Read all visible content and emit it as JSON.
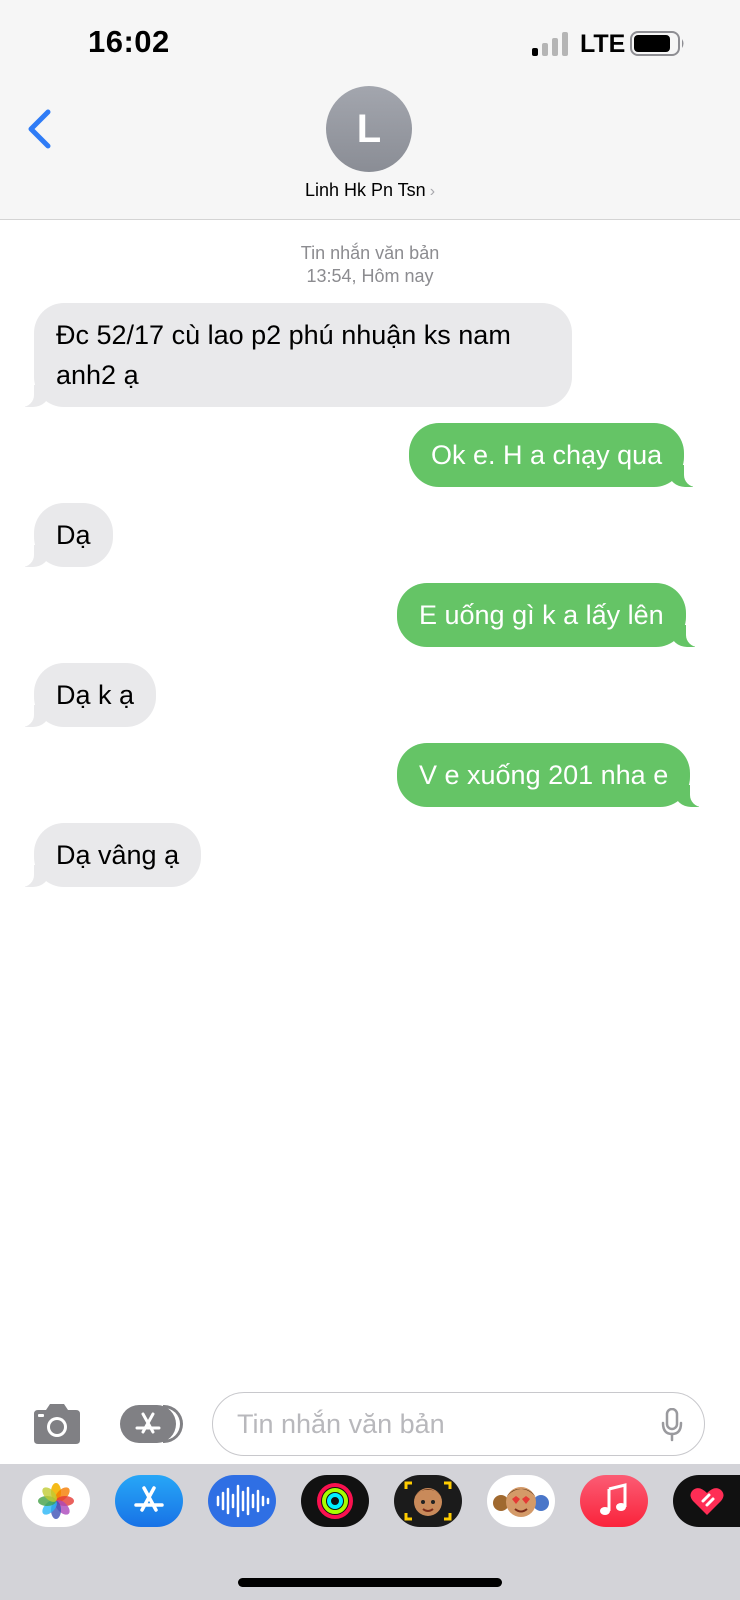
{
  "status": {
    "time": "16:02",
    "network": "LTE"
  },
  "contact": {
    "initial": "L",
    "name": "Linh Hk Pn Tsn",
    "chevron": "›"
  },
  "conversation": {
    "service_label": "Tin nhắn văn bản",
    "timestamp": "13:54, Hôm nay",
    "messages": [
      {
        "direction": "incoming",
        "text": "Đc 52/17 cù lao p2 phú nhuận ks nam anh2 ạ"
      },
      {
        "direction": "outgoing",
        "text": "Ok e. H a chạy qua"
      },
      {
        "direction": "incoming",
        "text": "Dạ"
      },
      {
        "direction": "outgoing",
        "text": "E uống gì k a lấy lên"
      },
      {
        "direction": "incoming",
        "text": "Dạ k ạ"
      },
      {
        "direction": "outgoing",
        "text": "V e xuống 201 nha e"
      },
      {
        "direction": "incoming",
        "text": "Dạ vâng ạ"
      }
    ]
  },
  "composer": {
    "placeholder": "Tin nhắn văn bản"
  },
  "app_drawer": [
    "photos-icon",
    "app-store-icon",
    "audio-message-icon",
    "activity-icon",
    "memoji-stickers-icon",
    "memoji-icon",
    "music-icon",
    "digital-touch-icon"
  ],
  "colors": {
    "accent_blue": "#2f7cf6",
    "outgoing_bubble": "#65c466",
    "incoming_bubble": "#e9e9eb",
    "header_bg": "#f6f6f6"
  }
}
